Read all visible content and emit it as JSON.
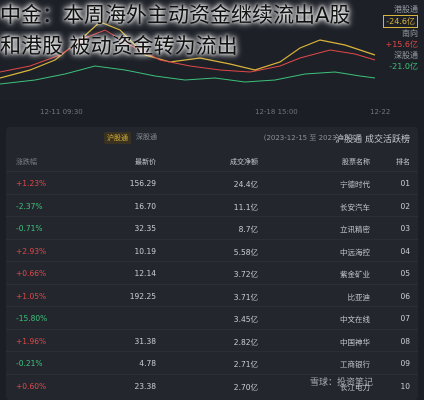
{
  "headline": {
    "line1": "中金：本周海外主动资金继续流出A股",
    "line2": "和港股 被动资金转为流出"
  },
  "legend": {
    "item1_label": "港股通",
    "item1_value": "-24.6亿",
    "item2_label": "南向",
    "item2_value": "+15.6亿",
    "item3_label": "深股通",
    "item3_value": "-21.0亿"
  },
  "xaxis": {
    "left": "12-11 09:30",
    "mid": "12-18 15:00",
    "right": "12-22"
  },
  "panel": {
    "title": "沪股通 成交活跃榜",
    "range": "(2023-12-15 至 2023-12-22)",
    "badge": "沪股通",
    "toggle": "深股通"
  },
  "columns": {
    "rank": "排名",
    "name": "股票名称",
    "amount": "成交净额",
    "price": "最新价",
    "change": "涨跌幅"
  },
  "rows": [
    {
      "rank": "01",
      "name": "宁德时代",
      "amount": "24.4亿",
      "price": "156.29",
      "change": "+1.23%",
      "dir": "up"
    },
    {
      "rank": "02",
      "name": "长安汽车",
      "amount": "11.1亿",
      "price": "16.70",
      "change": "-2.37%",
      "dir": "dn"
    },
    {
      "rank": "03",
      "name": "立讯精密",
      "amount": "8.7亿",
      "price": "32.35",
      "change": "-0.71%",
      "dir": "dn"
    },
    {
      "rank": "04",
      "name": "中远海控",
      "amount": "5.58亿",
      "price": "10.19",
      "change": "+2.93%",
      "dir": "up"
    },
    {
      "rank": "05",
      "name": "紫金矿业",
      "amount": "3.72亿",
      "price": "12.14",
      "change": "+0.66%",
      "dir": "up"
    },
    {
      "rank": "06",
      "name": "比亚迪",
      "amount": "3.71亿",
      "price": "192.25",
      "change": "+1.05%",
      "dir": "up"
    },
    {
      "rank": "07",
      "name": "中文在线",
      "amount": "3.45亿",
      "price": "",
      "change": "-15.80%",
      "dir": "dn"
    },
    {
      "rank": "08",
      "name": "中国神华",
      "amount": "2.82亿",
      "price": "31.38",
      "change": "+1.96%",
      "dir": "up"
    },
    {
      "rank": "09",
      "name": "工商银行",
      "amount": "2.71亿",
      "price": "4.78",
      "change": "-0.21%",
      "dir": "dn"
    },
    {
      "rank": "10",
      "name": "长江电力",
      "amount": "2.70亿",
      "price": "23.38",
      "change": "+0.60%",
      "dir": "up"
    }
  ],
  "watermark": "雪球：投资笔记"
}
